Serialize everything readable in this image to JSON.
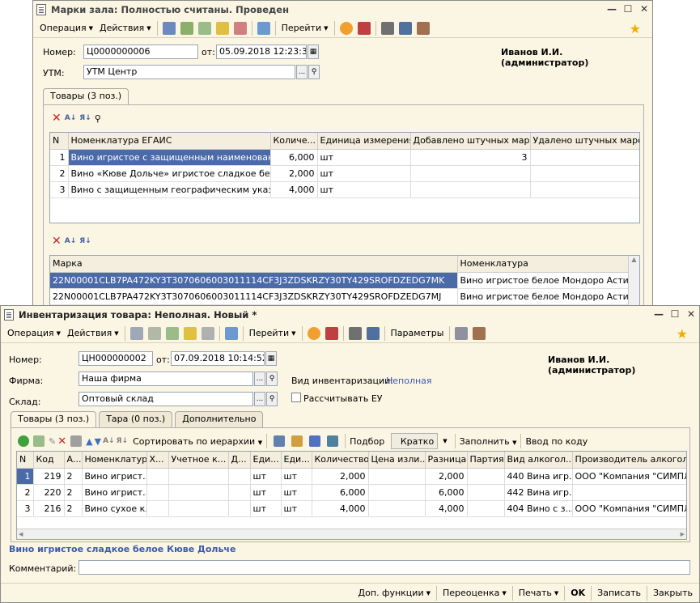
{
  "win1": {
    "title": "Марки зала: Полностью считаны. Проведен",
    "toolbar": {
      "operation": "Операция",
      "actions": "Действия",
      "goto": "Перейти"
    },
    "number_label": "Номер:",
    "number": "Ц0000000006",
    "from_label": "от:",
    "date": "05.09.2018 12:23:38",
    "user": "Иванов И.И. (администратор)",
    "utm_label": "УТМ:",
    "utm": "УТМ Центр",
    "tab": "Товары (3 поз.)",
    "goods_columns": [
      "N",
      "Номенклатура ЕГАИС",
      "Количе...",
      "Единица измерения",
      "Добавлено штучных марок",
      "Удалено штучных марок"
    ],
    "goods_rows": [
      [
        "1",
        "Вино игристое с защищенным наименование...",
        "6,000",
        "шт",
        "3",
        ""
      ],
      [
        "2",
        "Вино «Кюве Дольче» игристое сладкое белое",
        "2,000",
        "шт",
        "",
        ""
      ],
      [
        "3",
        "Вино с защищенным географическим указан...",
        "4,000",
        "шт",
        "",
        ""
      ]
    ],
    "marks_columns": [
      "Марка",
      "Номенклатура"
    ],
    "marks_rows": [
      [
        "22N00001CLB7PA472KY3T3070606003011114CF3J3ZDSKRZY30TY429SROFDZEDG7MK",
        "Вино игристое белое Мондоро Асти"
      ],
      [
        "22N00001CLB7PA472KY3T3070606003011114CF3J3ZDSKRZY30TY429SROFDZEDG7MJ",
        "Вино игристое белое Мондоро Асти"
      ]
    ]
  },
  "win2": {
    "title": "Инвентаризация товара: Неполная. Новый *",
    "toolbar": {
      "operation": "Операция",
      "actions": "Действия",
      "goto": "Перейти",
      "params": "Параметры"
    },
    "number_label": "Номер:",
    "number": "ЦН000000002",
    "from_label": "от:",
    "date": "07.09.2018 10:14:52",
    "user": "Иванов И.И. (администратор)",
    "firm_label": "Фирма:",
    "firm": "Наша фирма",
    "inv_type_label": "Вид инвентаризации:",
    "inv_type": "Неполная",
    "warehouse_label": "Склад:",
    "warehouse": "Оптовый склад",
    "calc_eu": "Рассчитывать ЕУ",
    "tabs": [
      "Товары (3 поз.)",
      "Тара (0 поз.)",
      "Дополнительно"
    ],
    "grid_toolbar": {
      "sort": "Сортировать по иерархии",
      "select": "Подбор",
      "brief": "Кратко",
      "fill": "Заполнить",
      "enter_code": "Ввод по коду"
    },
    "columns": [
      "N",
      "Код",
      "А...",
      "Номенклатура",
      "Х...",
      "Учетное к...",
      "Д...",
      "Еди...",
      "Еди...",
      "Количество",
      "Цена изли...",
      "Разница",
      "Партия",
      "Вид алкогол...",
      "Производитель алкоголя"
    ],
    "rows": [
      [
        "1",
        "219",
        "2",
        "Вино игрист...",
        "",
        "",
        "",
        "шт",
        "шт",
        "2,000",
        "",
        "2,000",
        "",
        "440 Вина игр...",
        "ООО \"Компания \"СИМПЛ"
      ],
      [
        "2",
        "220",
        "2",
        "Вино игрист...",
        "",
        "",
        "",
        "шт",
        "шт",
        "6,000",
        "",
        "6,000",
        "",
        "442 Вина игр...",
        ""
      ],
      [
        "3",
        "216",
        "2",
        "Вино сухое к...",
        "",
        "",
        "",
        "шт",
        "шт",
        "4,000",
        "",
        "4,000",
        "",
        "404 Вино с з...",
        "ООО \"Компания \"СИМПЛ"
      ]
    ],
    "selected_item": "Вино игристое сладкое белое Кюве Дольче",
    "comment_label": "Комментарий:",
    "comment": "",
    "bottom": {
      "extra": "Доп. функции",
      "revaluation": "Переоценка",
      "print": "Печать",
      "ok": "OK",
      "save": "Записать",
      "close": "Закрыть"
    }
  },
  "colors": {
    "accent": "#4a6aa8",
    "window_bg": "#fbf5e3",
    "link": "#3a5ab0"
  }
}
